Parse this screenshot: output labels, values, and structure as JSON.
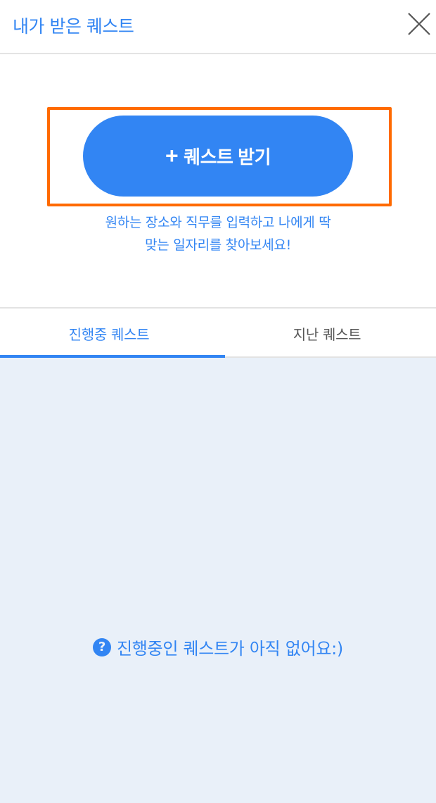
{
  "header": {
    "title": "내가 받은 퀘스트",
    "close_icon": "close-icon"
  },
  "cta": {
    "button_icon": "plus-icon",
    "button_plus": "+",
    "button_label": "퀘스트 받기",
    "description_line1": "원하는 장소와 직무를 입력하고 나에게 딱",
    "description_line2": "맞는 일자리를 찾아보세요!"
  },
  "tabs": [
    {
      "label": "진행중 퀘스트",
      "active": true
    },
    {
      "label": "지난 퀘스트",
      "active": false
    }
  ],
  "empty_state": {
    "icon": "question-circle-icon",
    "icon_glyph": "?",
    "message": "진행중인 퀘스트가 아직 없어요:)"
  },
  "colors": {
    "accent": "#3285f3",
    "highlight": "#ff6a00",
    "content_bg": "#e9f0f9",
    "inactive_tab": "#555555"
  }
}
